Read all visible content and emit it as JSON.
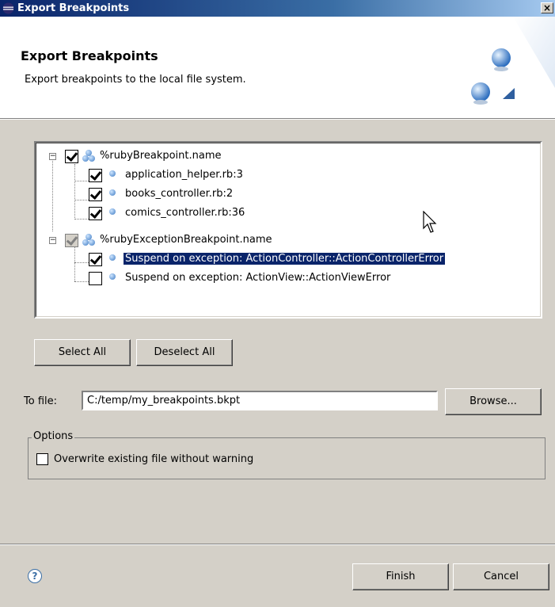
{
  "window": {
    "title": "Export Breakpoints",
    "close_label": "×"
  },
  "header": {
    "title": "Export Breakpoints",
    "description": "Export breakpoints to the local file system."
  },
  "tree": {
    "groups": [
      {
        "label": "%rubyBreakpoint.name",
        "checked": true,
        "items": [
          {
            "label": "application_helper.rb:3",
            "checked": true
          },
          {
            "label": "books_controller.rb:2",
            "checked": true
          },
          {
            "label": "comics_controller.rb:36",
            "checked": true
          }
        ]
      },
      {
        "label": "%rubyExceptionBreakpoint.name",
        "checked": "partial",
        "items": [
          {
            "label": "Suspend on exception: ActionController::ActionControllerError",
            "checked": true,
            "selected": true
          },
          {
            "label": "Suspend on exception: ActionView::ActionViewError",
            "checked": false
          }
        ]
      }
    ]
  },
  "buttons": {
    "select_all": "Select All",
    "deselect_all": "Deselect All",
    "browse": "Browse...",
    "finish": "Finish",
    "cancel": "Cancel"
  },
  "to_file": {
    "label": "To file:",
    "value": "C:/temp/my_breakpoints.bkpt"
  },
  "options": {
    "legend": "Options",
    "overwrite_label": "Overwrite existing file without warning",
    "overwrite_checked": false
  },
  "help": {
    "glyph": "?"
  },
  "colors": {
    "selection": "#0a246a",
    "titlebar": "#0a246a",
    "dialog_bg": "#d4d0c8"
  }
}
